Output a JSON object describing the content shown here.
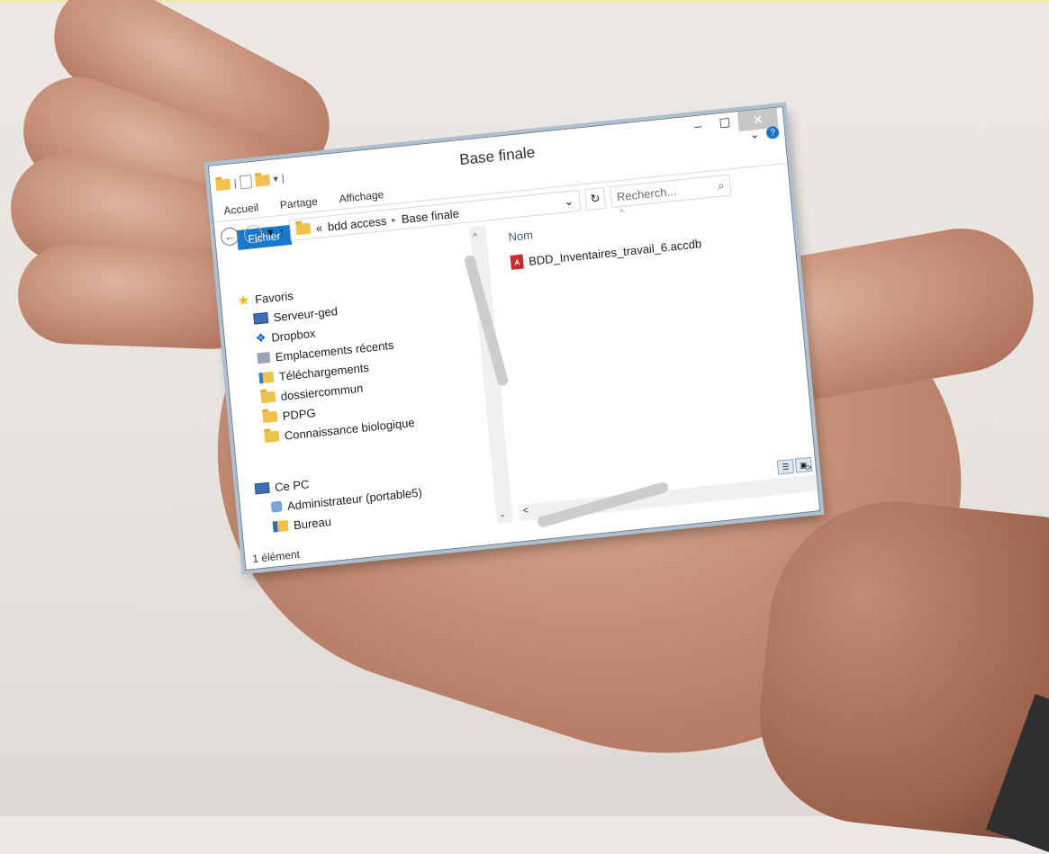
{
  "window": {
    "title": "Base finale",
    "minimize": "–",
    "maximize": "☐",
    "close": "✕"
  },
  "ribbon": {
    "tabs": [
      "Fichier",
      "Accueil",
      "Partage",
      "Affichage"
    ],
    "expand": "⌄",
    "help": "?"
  },
  "nav": {
    "back": "←",
    "forward": "→",
    "recent": "▾",
    "up": "↑",
    "address": {
      "prefix": "«",
      "crumb1": "bdd access",
      "sep": "▸",
      "crumb2": "Base finale",
      "dropdown": "⌄"
    },
    "refresh": "↻",
    "search_placeholder": "Recherch...",
    "search_icon": "⌕"
  },
  "sidebar": {
    "favorites": "Favoris",
    "items": [
      {
        "label": "Serveur-ged",
        "icon": "network-pc-icon"
      },
      {
        "label": "Dropbox",
        "icon": "dropbox-icon"
      },
      {
        "label": "Emplacements récents",
        "icon": "recent-places-icon"
      },
      {
        "label": "Téléchargements",
        "icon": "downloads-folder-icon"
      },
      {
        "label": "dossiercommun",
        "icon": "folder-icon"
      },
      {
        "label": "PDPG",
        "icon": "folder-icon"
      },
      {
        "label": "Connaissance biologique",
        "icon": "folder-icon"
      }
    ],
    "this_pc": "Ce PC",
    "pc_items": [
      {
        "label": "Administrateur (portable5)",
        "icon": "user-folder-icon"
      },
      {
        "label": "Bureau",
        "icon": "desktop-folder-icon"
      }
    ]
  },
  "content": {
    "column_name": "Nom",
    "sort_arrow": "^",
    "files": [
      {
        "name": "BDD_Inventaires_travail_6.accdb",
        "icon": "access-db-icon"
      }
    ]
  },
  "status": {
    "count": "1 élément"
  },
  "scroll": {
    "up": "^",
    "down": "⌄",
    "left": "<",
    "right": ">"
  }
}
